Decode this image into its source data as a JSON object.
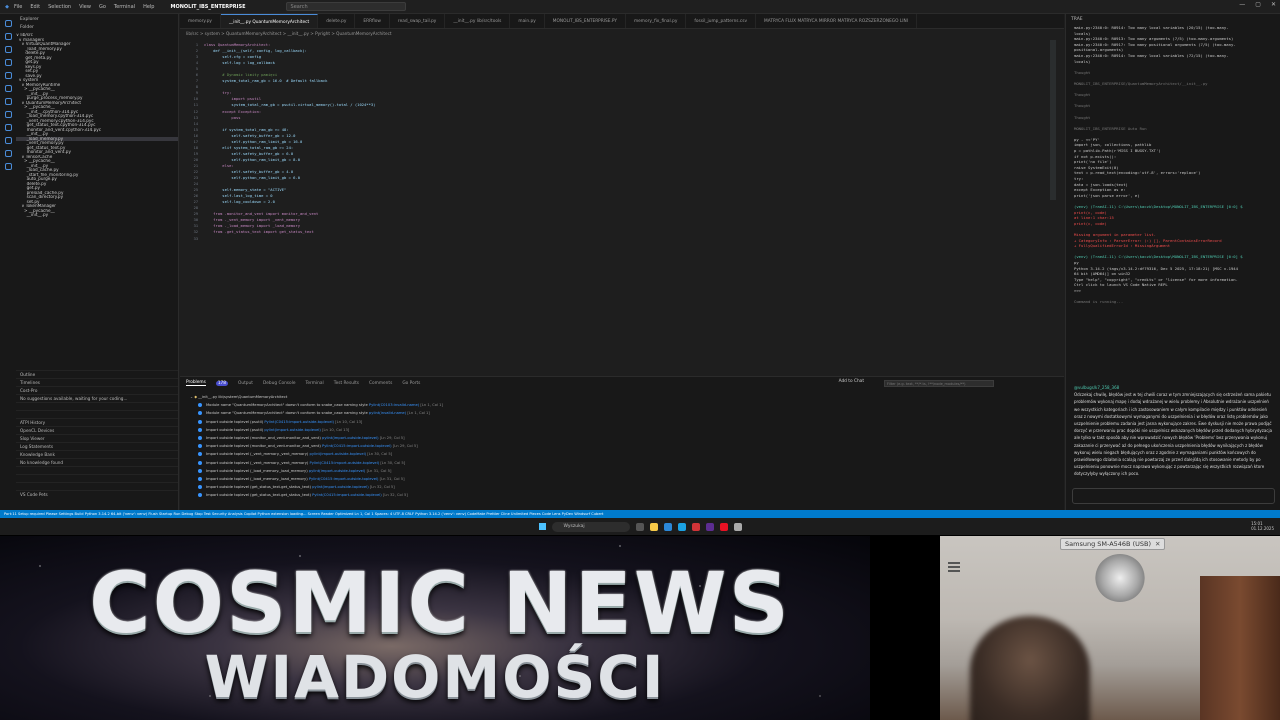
{
  "titlebar": {
    "menu": [
      "File",
      "Edit",
      "Selection",
      "View",
      "Go",
      "Terminal",
      "Help"
    ],
    "project": "MONOLIT_IBS_ENTERPRISE",
    "search": "Search"
  },
  "explorer": {
    "title": "Explorer",
    "folder": "Folder",
    "items": [
      "∨ lib/src",
      "  ∨ managers",
      "    ∨ VirtualQuantManager",
      "       _load_memory.py",
      "       delete.py",
      "       get_meta.py",
      "       get.py",
      "       keys.py",
      "       set.py",
      "       save.py",
      "  ∨ system",
      "    ∨ MemoryRuntime",
      "      > __pycache__",
      "        __init__.py",
      "        purge_process_memory.py",
      "    ∨ QuantumMemoryArchitect",
      "      > __pycache__",
      "        __init__.cpython-314.pyc",
      "        _load_memory.cpython-314.pyc",
      "        _vent_memory.cpython-314.pyc",
      "        get_status_text.cpython-314.pyc",
      "        monitor_and_vent.cpython-314.pyc",
      "        __init__.py",
      "        _load_memory.py",
      "        _vent_memory.py",
      "        get_status_text.py",
      "        monitor_and_vent.py",
      "    ∨ TensorCache",
      "      > __pycache__",
      "        __init__.py",
      "        _load_cache.py",
      "        _start_file_monitoring.py",
      "        auto_purge.py",
      "        delete.py",
      "        get.py",
      "        preload_cache.py",
      "        scan_directory.py",
      "        set.py",
      "    ∨ TokenManager",
      "      > __pycache__",
      "        __init__.py"
    ],
    "sections": [
      "Outline",
      "Timelines",
      "Cost-Pro",
      "No suggestions available, waiting for your coding...",
      "",
      "",
      "ATPI History",
      "OpenCL Devices",
      "Slop Viewer",
      "Log Statements",
      "Knowledge Bank",
      "No knowledge found",
      "",
      "",
      "",
      "VS Code Pets"
    ]
  },
  "tabs": [
    "memory.py",
    "__init__.py  QuantumMemoryArchitect",
    "delete.py",
    "ERRflow",
    "read_swap_tail.py",
    "__init__.py  lib/src/tools",
    "main.py",
    "MONOLIT_IBS_ENTERPRISE.PY",
    "memory_fix_final.py",
    "fossil_jump_patterns.csv",
    "MATRYCA FLUX MATRYCA MIRROR MATRYCA ROZSZERZONEGO LINI"
  ],
  "breadcrumb": "lib/src  >  system  >  QuantumMemoryArchitect  >  __init__.py  >  Pyright  >  QuantumMemoryArchitect",
  "code": [
    {
      "t": "class QuantumMemoryArchitect:",
      "k": "k"
    },
    {
      "t": "    def __init__(self, config, log_callback):",
      "k": ""
    },
    {
      "t": "        self.cfg = config",
      "k": ""
    },
    {
      "t": "        self.log = log_callback",
      "k": ""
    },
    {
      "t": "",
      "k": ""
    },
    {
      "t": "        # Dynamic limity pamięci",
      "k": "c"
    },
    {
      "t": "        system_total_ram_gb = 16.0  # Default fallback",
      "k": ""
    },
    {
      "t": "",
      "k": ""
    },
    {
      "t": "        try:",
      "k": "k"
    },
    {
      "t": "            import psutil",
      "k": "k"
    },
    {
      "t": "            system_total_ram_gb = psutil.virtual_memory().total / (1024**3)",
      "k": ""
    },
    {
      "t": "        except Exception:",
      "k": "k"
    },
    {
      "t": "            pass",
      "k": "k"
    },
    {
      "t": "",
      "k": ""
    },
    {
      "t": "        if system_total_ram_gb >= 48:",
      "k": ""
    },
    {
      "t": "            self.safety_buffer_gb = 12.0",
      "k": ""
    },
    {
      "t": "            self.python_ram_limit_gb = 16.0",
      "k": ""
    },
    {
      "t": "        elif system_total_ram_gb >= 24:",
      "k": ""
    },
    {
      "t": "            self.safety_buffer_gb = 6.0",
      "k": ""
    },
    {
      "t": "            self.python_ram_limit_gb = 8.0",
      "k": ""
    },
    {
      "t": "        else:",
      "k": "k"
    },
    {
      "t": "            self.safety_buffer_gb = 4.0",
      "k": ""
    },
    {
      "t": "            self.python_ram_limit_gb = 6.0",
      "k": ""
    },
    {
      "t": "",
      "k": ""
    },
    {
      "t": "        self.memory_state = \"ACTIVE\"",
      "k": ""
    },
    {
      "t": "        self.last_log_time = 0",
      "k": ""
    },
    {
      "t": "        self.log_cooldown = 2.0",
      "k": ""
    },
    {
      "t": "",
      "k": ""
    },
    {
      "t": "    from .monitor_and_vent import monitor_and_vent",
      "k": "k"
    },
    {
      "t": "    from ._vent_memory import _vent_memory",
      "k": "k"
    },
    {
      "t": "    from ._load_memory import _load_memory",
      "k": "k"
    },
    {
      "t": "    from .get_status_text import get_status_text",
      "k": "k"
    },
    {
      "t": "",
      "k": ""
    }
  ],
  "panel": {
    "tabs": [
      "Problems",
      "Output",
      "Debug Console",
      "Terminal",
      "Test Results",
      "Comments",
      "Go Ports"
    ],
    "problem_count": "178",
    "add_to_chat": "Add to Chat",
    "filter_placeholder": "Filter (e.g. text, **/*.ts, !**/node_modules/**)",
    "file": "__init__.py  lib\\system\\QuantumMemoryArchitect",
    "problems": [
      {
        "msg": "Module name \"QuantumMemoryArchitect\" doesn't conform to snake_case naming style",
        "src": "Pylint(C0103:invalid-name)",
        "loc": "[Ln 1, Col 1]"
      },
      {
        "msg": "Module name \"QuantumMemoryArchitect\" doesn't conform to snake_case naming style",
        "src": "pylint(invalid-name)",
        "loc": "[Ln 1, Col 1]"
      },
      {
        "msg": "Import outside toplevel (psutil)",
        "src": "Pylint(C0415:import-outside-toplevel)",
        "loc": "[Ln 10, Col 13]"
      },
      {
        "msg": "Import outside toplevel (psutil)",
        "src": "pylint(import-outside-toplevel)",
        "loc": "[Ln 10, Col 13]"
      },
      {
        "msg": "Import outside toplevel (monitor_and_vent.monitor_and_vent)",
        "src": "pylint(import-outside-toplevel)",
        "loc": "[Ln 29, Col 5]"
      },
      {
        "msg": "Import outside toplevel (monitor_and_vent.monitor_and_vent)",
        "src": "Pylint(C0415:import-outside-toplevel)",
        "loc": "[Ln 29, Col 5]"
      },
      {
        "msg": "Import outside toplevel (_vent_memory._vent_memory)",
        "src": "pylint(import-outside-toplevel)",
        "loc": "[Ln 30, Col 5]"
      },
      {
        "msg": "Import outside toplevel (_vent_memory._vent_memory)",
        "src": "Pylint(C0415:import-outside-toplevel)",
        "loc": "[Ln 30, Col 5]"
      },
      {
        "msg": "Import outside toplevel (_load_memory._load_memory)",
        "src": "pylint(import-outside-toplevel)",
        "loc": "[Ln 31, Col 5]"
      },
      {
        "msg": "Import outside toplevel (_load_memory._load_memory)",
        "src": "Pylint(C0415:import-outside-toplevel)",
        "loc": "[Ln 31, Col 5]"
      },
      {
        "msg": "Import outside toplevel (get_status_text.get_status_text)",
        "src": "pylint(import-outside-toplevel)",
        "loc": "[Ln 32, Col 5]"
      },
      {
        "msg": "Import outside toplevel (get_status_text.get_status_text)",
        "src": "Pylint(C0415:import-outside-toplevel)",
        "loc": "[Ln 32, Col 5]"
      }
    ]
  },
  "chat": {
    "title": "TRAE",
    "terminal": [
      {
        "t": "main.py:2340:0: R0914: Too many local variables (20/15) (too-many-",
        "c": ""
      },
      {
        "t": "locals)",
        "c": ""
      },
      {
        "t": "main.py:2340:0: R0913: Too many arguments (7/5) (too-many-arguments)",
        "c": ""
      },
      {
        "t": "main.py:2340:0: R0917: Too many positional arguments (7/5) (too-many-",
        "c": ""
      },
      {
        "t": "positional-arguments)",
        "c": ""
      },
      {
        "t": "main.py:2340:0: R0914: Too many local variables (72/15) (too-many-",
        "c": ""
      },
      {
        "t": "locals)",
        "c": ""
      },
      {
        "t": "",
        "c": ""
      },
      {
        "t": "Thought",
        "c": "dim"
      },
      {
        "t": "",
        "c": ""
      },
      {
        "t": "MONOLIT_IBS_ENTERPRISE/QuantumMemoryArchitect/__init__.py",
        "c": "dim"
      },
      {
        "t": "",
        "c": ""
      },
      {
        "t": "Thought",
        "c": "dim"
      },
      {
        "t": "",
        "c": ""
      },
      {
        "t": "Thought",
        "c": "dim"
      },
      {
        "t": "",
        "c": ""
      },
      {
        "t": "Thought",
        "c": "dim"
      },
      {
        "t": "",
        "c": ""
      },
      {
        "t": "MONOLIT_IBS_ENTERPRISE   Auto Run",
        "c": "dim"
      },
      {
        "t": "",
        "c": ""
      },
      {
        "t": "py - <<'PY'",
        "c": ""
      },
      {
        "t": "import json, collections, pathlib",
        "c": ""
      },
      {
        "t": "p = pathlib.Path(r'MISS I BUGSY.TXT')",
        "c": ""
      },
      {
        "t": "if not p.exists():",
        "c": ""
      },
      {
        "t": "    print('no file')",
        "c": ""
      },
      {
        "t": "    raise SystemExit(0)",
        "c": ""
      },
      {
        "t": "text = p.read_text(encoding='utf-8', errors='replace')",
        "c": ""
      },
      {
        "t": "try:",
        "c": ""
      },
      {
        "t": "    data = json.loads(text)",
        "c": ""
      },
      {
        "t": "except Exception as e:",
        "c": ""
      },
      {
        "t": "    print('json parse error', e)",
        "c": ""
      },
      {
        "t": "",
        "c": ""
      },
      {
        "t": "(venv) (TraeAI-11) C:\\Users\\kaczk\\Desktop\\MONOLIT_IBS_ENTERPRISE [0:0] $",
        "c": "grn"
      },
      {
        "t": "  print(c, code)",
        "c": "err"
      },
      {
        "t": "  at line:1 char:15",
        "c": "err"
      },
      {
        "t": "  print(c, code)",
        "c": "err"
      },
      {
        "t": "",
        "c": ""
      },
      {
        "t": "Missing argument in parameter list.",
        "c": "err"
      },
      {
        "t": "  + CategoryInfo          : ParserError: (:) [], ParentContainsErrorRecord",
        "c": "err"
      },
      {
        "t": "  + FullyQualifiedErrorId : MissingArgument",
        "c": "err"
      },
      {
        "t": "",
        "c": ""
      },
      {
        "t": "(venv) (TraeAI-11) C:\\Users\\kaczk\\Desktop\\MONOLIT_IBS_ENTERPRISE [0:0] $",
        "c": "grn"
      },
      {
        "t": "py",
        "c": ""
      },
      {
        "t": "Python 3.14.2 (tags/v3.14.2:df79316, Dec  5 2025, 17:18:21) [MSC v.1944",
        "c": ""
      },
      {
        "t": "64 bit (AMD64)] on win32",
        "c": ""
      },
      {
        "t": "Type \"help\", \"copyright\", \"credits\" or \"license\" for more information.",
        "c": ""
      },
      {
        "t": "Ctrl click to launch VS Code Native REPL",
        "c": ""
      },
      {
        "t": ">>>",
        "c": ""
      },
      {
        "t": "",
        "c": ""
      },
      {
        "t": "Command is running...",
        "c": "dim"
      }
    ],
    "user": "@vulbugs/k7_258_368",
    "message": "Odczekaj chwilę, błędów jest w tej chwili coraz w tym zmniejszających się ostrzeżeń sama pakietu problemów wykonaj mapę i dodaj wdrażanej w wielu problemy i Absolutnie wdrażanie uszpelnień we wszystkich kategoriach i ich zastosowaniem w całym kompilacie między i punktów odniesień oraz z nowymi dostatkowymi wymaganymi do uszpelnienia i w błędów oraz listę problemów jako uszpelnienie problemu zadania jest jasna wykonujące zakres. Ewe dyskusji nie może prawa podjąć dorzyć w przerwaniu prac dopóki nie uszpelnisz wskazanych błędów przed dodanych hybrydyzacja ale tylko w takt sposób aby nie wprowadzić nowych błędów 'Problems' bez przerywania wykonuj zakazanie ci przerywać aż do pełnego ukończenia uszpelnienia błędów wynikających z błędów wykonuj wielu niegach błędujących oraz z zgodnie z wymaganiami punktów końcowych do prawidłowego działania scalają nie powtarzaj ze przed dalejśdą ich stosowanie metody by po uszpelnieniu ponownie mocz naprawa wykonując z powtarzając się wszystkich rozwiązań ktore dotyczyłyby wyłączony ich poco."
  },
  "statusbar": "Port:11 Setup required  Please Settings  Build  Python 3.14.2 64-bit ('venv': venv)  Flush  Startup  Run  Debug  Stop  Test  Security Analysis  Copilot  Python extension loading...        Screen Reader Optimized  Ln 1, Col 1  Spaces: 4  UTF-8  CRLF  Python  3.14.2 ('venv': venv)  CodeMate  Prettier  Cline  Unlimited  Pieces Code Lens  PyDev  Windsurf  Cubert",
  "taskbar": {
    "search": "Wyszukaj",
    "time": "15:01",
    "date": "01.12.2025"
  },
  "banner": {
    "line1": "COSMIC NEWS",
    "line2": "WIADOMOŚCI"
  },
  "webcam": {
    "device": "Samsung SM-A546B (USB)"
  }
}
